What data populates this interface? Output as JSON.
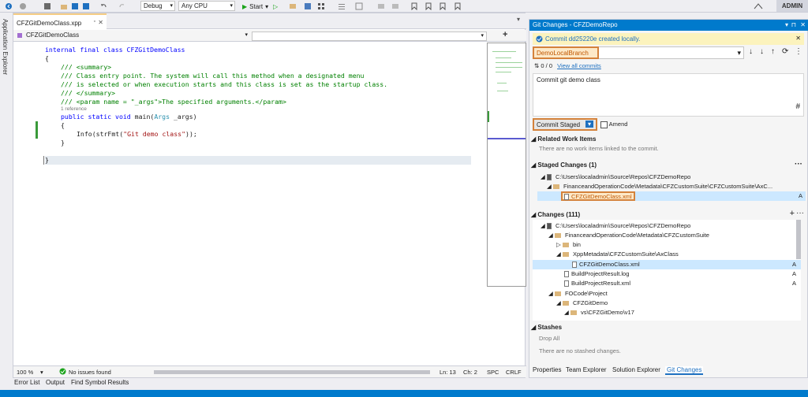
{
  "toolbar": {
    "config": "Debug",
    "platform": "Any CPU",
    "start_label": "Start",
    "admin": "ADMIN"
  },
  "side": {
    "app_explorer": "Application Explorer"
  },
  "editor": {
    "tab": "CFZGitDemoClass.xpp",
    "nav_left": "CFZGitDemoClass",
    "code": {
      "l1": "internal final class CFZGitDemoClass",
      "l2": "{",
      "l3": "/// <summary>",
      "l4": "/// Class entry point. The system will call this method when a designated menu",
      "l5": "/// is selected or when execution starts and this class is set as the startup class.",
      "l6": "/// </summary>",
      "l7": "/// <param name = \"_args\">The specified arguments.</param>",
      "ref": "1 reference",
      "l8a": "public static void",
      "l8b": " main(",
      "l8c": "Args",
      "l8d": " _args)",
      "l9": "{",
      "l10a": "Info(strFmt(",
      "l10b": "\"Git demo class\"",
      "l10c": "));",
      "l11": "}",
      "l12": "}"
    },
    "status": {
      "zoom": "100 %",
      "issues": "No issues found",
      "ln": "Ln: 13",
      "ch": "Ch: 2",
      "spc": "SPC",
      "crlf": "CRLF"
    }
  },
  "bottom_tabs": [
    "Error List",
    "Output",
    "Find Symbol Results"
  ],
  "git": {
    "title": "Git Changes - CFZDemoRepo",
    "info": "Commit dd25220e created locally.",
    "branch": "DemoLocalBranch",
    "sync": "0 / 0",
    "view_all": "View all commits",
    "message": "Commit git demo class",
    "commit_btn": "Commit Staged",
    "amend": "Amend",
    "related_title": "Related Work Items",
    "related_empty": "There are no work items linked to the commit.",
    "staged_title": "Staged Changes (1)",
    "staged_repo": "C:\\Users\\localadmin\\Source\\Repos\\CFZDemoRepo",
    "staged_path": "FinanceandOperationCode\\Metadata\\CFZCustomSuite\\CFZCustomSuite\\AxC...",
    "staged_file": "CFZGitDemoClass.xml",
    "changes_title": "Changes (111)",
    "changes_repo": "C:\\Users\\localadmin\\Source\\Repos\\CFZDemoRepo",
    "changes_path": "FinanceandOperationCode\\Metadata\\CFZCustomSuite",
    "bin": "bin",
    "axclass": "XppMetadata\\CFZCustomSuite\\AxClass",
    "f1": "CFZGitDemoClass.xml",
    "f2": "BuildProjectResult.log",
    "f3": "BuildProjectResult.xml",
    "fo_project": "FOCode\\Project",
    "cfzgitdemo": "CFZGitDemo",
    "vs": "vs\\CFZGitDemo\\v17",
    "stashes_title": "Stashes",
    "drop_all": "Drop All",
    "stash_empty": "There are no stashed changes.",
    "status_a": "A",
    "tabs": [
      "Properties",
      "Team Explorer",
      "Solution Explorer",
      "Git Changes"
    ]
  }
}
